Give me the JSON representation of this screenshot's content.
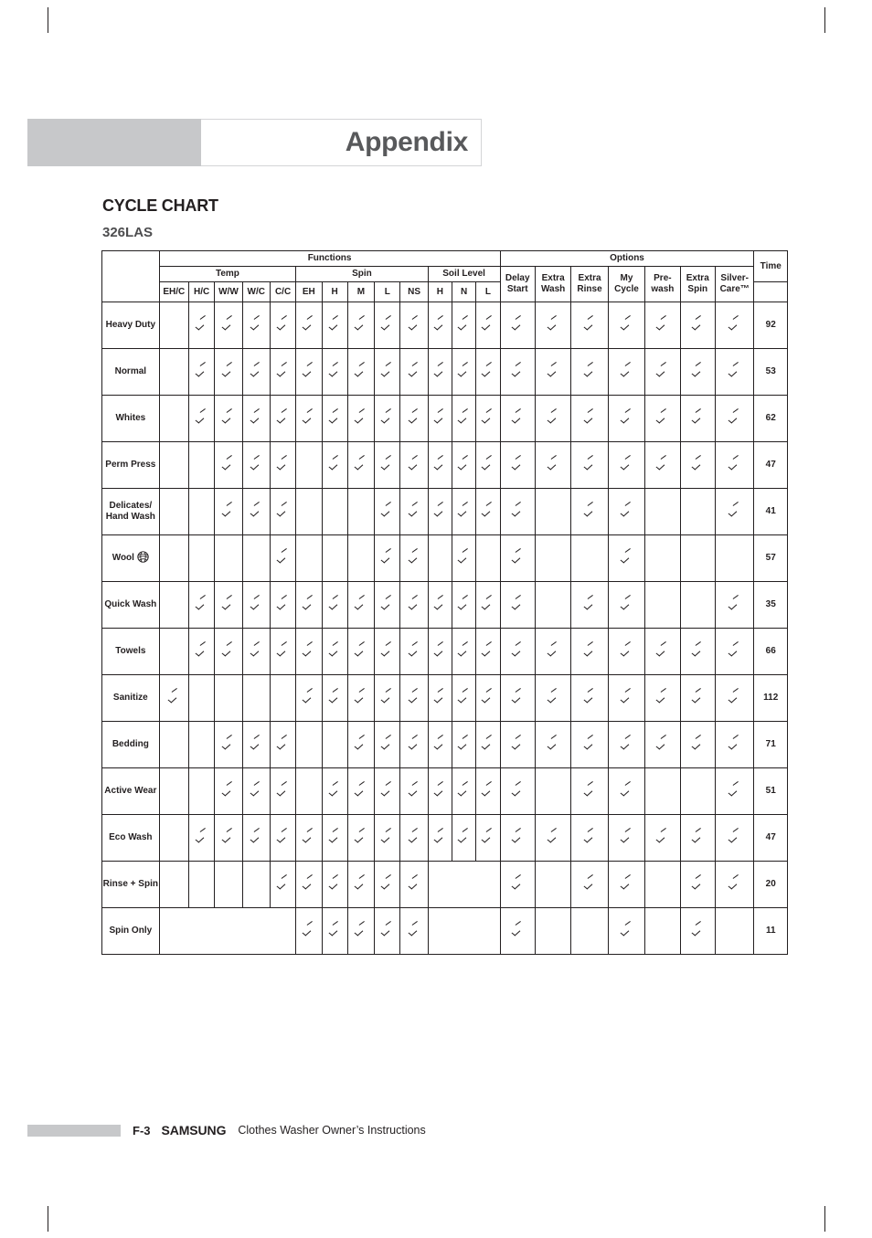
{
  "header": {
    "title": "Appendix"
  },
  "section": {
    "title": "CYCLE CHART",
    "model": "326LAS"
  },
  "table": {
    "group_headers": {
      "functions": "Functions",
      "options": "Options",
      "time": "Time"
    },
    "sub_headers": {
      "temp": "Temp",
      "spin": "Spin",
      "soil_level": "Soil Level"
    },
    "function_columns": [
      "EH/C",
      "H/C",
      "W/W",
      "W/C",
      "C/C",
      "EH",
      "H",
      "M",
      "L",
      "NS",
      "H",
      "N",
      "L"
    ],
    "temp_columns": [
      "EH/C",
      "H/C",
      "W/W",
      "W/C",
      "C/C"
    ],
    "spin_columns": [
      "EH",
      "H",
      "M",
      "L",
      "NS"
    ],
    "soil_columns": [
      "H",
      "N",
      "L"
    ],
    "option_columns": [
      "Delay Start",
      "Extra Wash",
      "Extra Rinse",
      "My Cycle",
      "Pre-wash",
      "Extra Spin",
      "Silver-Care™"
    ],
    "check_mark": "✓",
    "rows": [
      {
        "label": "Heavy Duty",
        "icon": null,
        "temp": [
          0,
          1,
          1,
          1,
          1
        ],
        "spin": [
          1,
          1,
          1,
          1,
          1
        ],
        "soil": [
          1,
          1,
          1
        ],
        "options": [
          1,
          1,
          1,
          1,
          1,
          1,
          1
        ],
        "time": "92"
      },
      {
        "label": "Normal",
        "icon": null,
        "temp": [
          0,
          1,
          1,
          1,
          1
        ],
        "spin": [
          1,
          1,
          1,
          1,
          1
        ],
        "soil": [
          1,
          1,
          1
        ],
        "options": [
          1,
          1,
          1,
          1,
          1,
          1,
          1
        ],
        "time": "53"
      },
      {
        "label": "Whites",
        "icon": null,
        "temp": [
          0,
          1,
          1,
          1,
          1
        ],
        "spin": [
          1,
          1,
          1,
          1,
          1
        ],
        "soil": [
          1,
          1,
          1
        ],
        "options": [
          1,
          1,
          1,
          1,
          1,
          1,
          1
        ],
        "time": "62"
      },
      {
        "label": "Perm Press",
        "icon": null,
        "temp": [
          0,
          0,
          1,
          1,
          1
        ],
        "spin": [
          0,
          1,
          1,
          1,
          1
        ],
        "soil": [
          1,
          1,
          1
        ],
        "options": [
          1,
          1,
          1,
          1,
          1,
          1,
          1
        ],
        "time": "47"
      },
      {
        "label": "Delicates/ Hand Wash",
        "icon": null,
        "temp": [
          0,
          0,
          1,
          1,
          1
        ],
        "spin": [
          0,
          0,
          0,
          1,
          1
        ],
        "soil": [
          1,
          1,
          1
        ],
        "options": [
          1,
          0,
          1,
          1,
          0,
          0,
          1
        ],
        "time": "41"
      },
      {
        "label": "Wool",
        "icon": "wool-ball-icon",
        "temp": [
          0,
          0,
          0,
          0,
          1
        ],
        "spin": [
          0,
          0,
          0,
          1,
          1
        ],
        "soil": [
          0,
          1,
          0
        ],
        "options": [
          1,
          0,
          0,
          1,
          0,
          0,
          0
        ],
        "time": "57"
      },
      {
        "label": "Quick Wash",
        "icon": null,
        "temp": [
          0,
          1,
          1,
          1,
          1
        ],
        "spin": [
          1,
          1,
          1,
          1,
          1
        ],
        "soil": [
          1,
          1,
          1
        ],
        "options": [
          1,
          0,
          1,
          1,
          0,
          0,
          1
        ],
        "time": "35"
      },
      {
        "label": "Towels",
        "icon": null,
        "temp": [
          0,
          1,
          1,
          1,
          1
        ],
        "spin": [
          1,
          1,
          1,
          1,
          1
        ],
        "soil": [
          1,
          1,
          1
        ],
        "options": [
          1,
          1,
          1,
          1,
          1,
          1,
          1
        ],
        "time": "66"
      },
      {
        "label": "Sanitize",
        "icon": null,
        "temp": [
          1,
          0,
          0,
          0,
          0
        ],
        "spin": [
          1,
          1,
          1,
          1,
          1
        ],
        "soil": [
          1,
          1,
          1
        ],
        "options": [
          1,
          1,
          1,
          1,
          1,
          1,
          1
        ],
        "time": "112"
      },
      {
        "label": "Bedding",
        "icon": null,
        "temp": [
          0,
          0,
          1,
          1,
          1
        ],
        "spin": [
          0,
          0,
          1,
          1,
          1
        ],
        "soil": [
          1,
          1,
          1
        ],
        "options": [
          1,
          1,
          1,
          1,
          1,
          1,
          1
        ],
        "time": "71"
      },
      {
        "label": "Active Wear",
        "icon": null,
        "temp": [
          0,
          0,
          1,
          1,
          1
        ],
        "spin": [
          0,
          1,
          1,
          1,
          1
        ],
        "soil": [
          1,
          1,
          1
        ],
        "options": [
          1,
          0,
          1,
          1,
          0,
          0,
          1
        ],
        "time": "51"
      },
      {
        "label": "Eco Wash",
        "icon": null,
        "temp": [
          0,
          1,
          1,
          1,
          1
        ],
        "spin": [
          1,
          1,
          1,
          1,
          1
        ],
        "soil": [
          1,
          1,
          1
        ],
        "options": [
          1,
          1,
          1,
          1,
          1,
          1,
          1
        ],
        "time": "47"
      },
      {
        "label": "Rinse + Spin",
        "icon": null,
        "temp": [
          0,
          0,
          0,
          0,
          1
        ],
        "spin": [
          1,
          1,
          1,
          1,
          1
        ],
        "soil": null,
        "options": [
          1,
          0,
          1,
          1,
          0,
          1,
          1
        ],
        "time": "20"
      },
      {
        "label": "Spin Only",
        "icon": null,
        "temp": null,
        "spin": [
          1,
          1,
          1,
          1,
          1
        ],
        "soil": null,
        "options": [
          1,
          0,
          0,
          1,
          0,
          1,
          0
        ],
        "time": "11"
      }
    ]
  },
  "footer": {
    "page": "F-3",
    "brand": "SAMSUNG",
    "document": "Clothes Washer Owner’s Instructions"
  }
}
